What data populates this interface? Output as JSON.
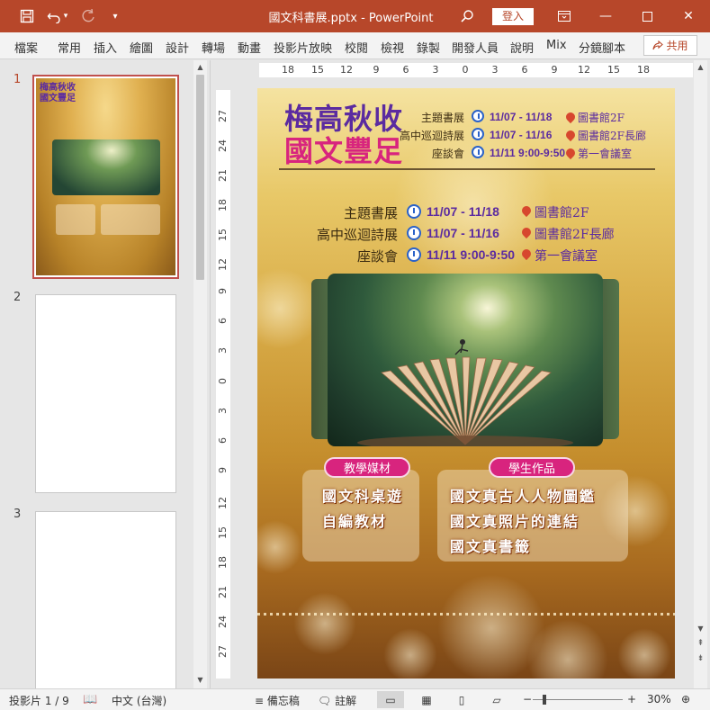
{
  "window": {
    "title": "國文科書展.pptx - PowerPoint",
    "sign_in": "登入",
    "quick_access": [
      "save-icon",
      "undo-icon",
      "redo-icon",
      "customize-icon"
    ]
  },
  "ribbon": {
    "tabs": [
      "檔案",
      "常用",
      "插入",
      "繪圖",
      "設計",
      "轉場",
      "動畫",
      "投影片放映",
      "校閱",
      "檢視",
      "錄製",
      "開發人員",
      "說明",
      "Mix",
      "分鏡腳本"
    ],
    "share_label": "共用"
  },
  "thumbnails": {
    "numbers": [
      "1",
      "2",
      "3"
    ],
    "selected": "1"
  },
  "rulers": {
    "horizontal": [
      "18",
      "15",
      "12",
      "9",
      "6",
      "3",
      "0",
      "3",
      "6",
      "9",
      "12",
      "15",
      "18"
    ],
    "vertical": [
      "27",
      "24",
      "21",
      "18",
      "15",
      "12",
      "9",
      "6",
      "3",
      "0",
      "3",
      "6",
      "9",
      "12",
      "15",
      "18",
      "21",
      "24",
      "27"
    ]
  },
  "slide": {
    "title_line1": "梅高秋收",
    "title_line2": "國文豐足",
    "schedule": [
      {
        "label": "主題書展",
        "date": "11/07 - 11/18",
        "place": "圖書館2F"
      },
      {
        "label": "高中巡迴詩展",
        "date": "11/07 - 11/16",
        "place": "圖書館2F長廊"
      },
      {
        "label": "座談會",
        "date": "11/11 9:00-9:50",
        "place": "第一會議室"
      }
    ],
    "header_schedule": [
      {
        "label": "主題書展",
        "date": "11/07 - 11/18",
        "place": "圖書館2F"
      },
      {
        "label": "高中巡迴詩展",
        "date": "11/07 - 11/16",
        "place": "圖書館2F長廊"
      },
      {
        "label": "座談會",
        "date": "11/11 9:00-9:50",
        "place": "第一會議室"
      }
    ],
    "left_panel": {
      "heading": "教學媒材",
      "lines": [
        "國文科桌遊",
        "自編教材"
      ]
    },
    "right_panel": {
      "heading": "學生作品",
      "lines": [
        "國文真古人人物圖鑑",
        "國文真照片的連結",
        "國文真書籤"
      ]
    }
  },
  "status": {
    "slide_info": "投影片 1 / 9",
    "language": "中文 (台灣)",
    "notes": "備忘稿",
    "comments": "註解",
    "zoom": "30%"
  },
  "colors": {
    "accent": "#b7472a",
    "title_purple": "#5b2ba0",
    "title_pink": "#d8247e",
    "pill": "#d8247e"
  }
}
